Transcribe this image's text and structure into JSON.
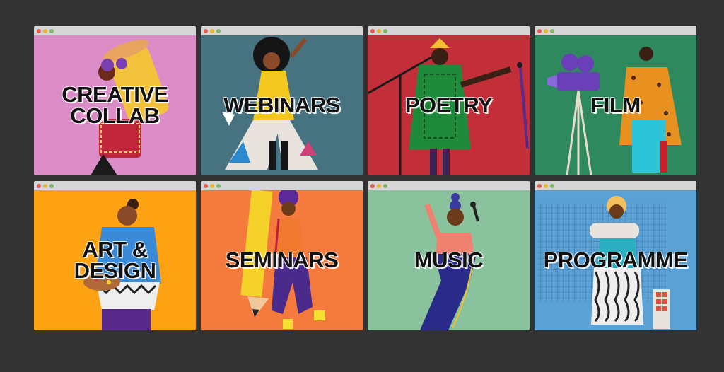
{
  "cards": [
    {
      "title": "CREATIVE\nCOLLAB",
      "bg": "#dc8cc6"
    },
    {
      "title": "WEBINARS",
      "bg": "#47727f"
    },
    {
      "title": "POETRY",
      "bg": "#c22f39"
    },
    {
      "title": "FILM",
      "bg": "#2e8a5e"
    },
    {
      "title": "ART &\nDESIGN",
      "bg": "#fca213"
    },
    {
      "title": "SEMINARS",
      "bg": "#f47b3d"
    },
    {
      "title": "MUSIC",
      "bg": "#8ac29d"
    },
    {
      "title": "PROGRAMME",
      "bg": "#5aa2d6"
    }
  ],
  "colors": {
    "page_bg": "#333333",
    "chrome_bar": "#d6d6d6",
    "dot_red": "#e45b4f",
    "dot_yellow": "#e6b532",
    "dot_green": "#7fb56b"
  }
}
